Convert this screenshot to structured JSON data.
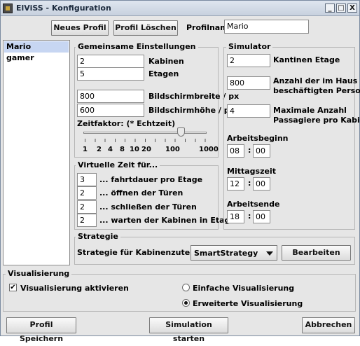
{
  "window": {
    "title": "ElViSS - Konfiguration",
    "min": "_",
    "max": "□",
    "close": "X"
  },
  "toolbar": {
    "new_profile": "Neues Profil",
    "delete_profile": "Profil Löschen",
    "profile_name_label": "Profilname",
    "profile_name_value": "Mario"
  },
  "profiles": [
    "Mario",
    "gamer"
  ],
  "common": {
    "title": "Gemeinsame Einstellungen",
    "kabinen_value": "2",
    "kabinen_label": "Kabinen",
    "etagen_value": "5",
    "etagen_label": "Etagen",
    "screen_width_value": "800",
    "screen_width_label": "Bildschirmbreite / px",
    "screen_height_value": "600",
    "screen_height_label": "Bildschirmhöhe / px",
    "zeitfaktor_label": "Zeitfaktor: (* Echtzeit)",
    "slider_ticks": [
      "1",
      "2",
      "4",
      "8",
      "10",
      "20",
      "100",
      "1000"
    ],
    "slider_selected": "100"
  },
  "virtual_time": {
    "title": "Virtuelle Zeit für...",
    "items": [
      {
        "value": "3",
        "label": "... fahrtdauer pro Etage"
      },
      {
        "value": "2",
        "label": "... öffnen der Türen"
      },
      {
        "value": "2",
        "label": "... schließen der Türen"
      },
      {
        "value": "2",
        "label": "... warten der Kabinen in Etage"
      }
    ]
  },
  "simulator": {
    "title": "Simulator",
    "kantinen_value": "2",
    "kantinen_label": "Kantinen Etage",
    "persons_value": "800",
    "persons_label_1": "Anzahl der im Haus",
    "persons_label_2": "beschäftigten Personen",
    "passengers_value": "4",
    "passengers_label_1": "Maximale Anzahl",
    "passengers_label_2": "Passagiere pro Kabine",
    "arbeitsbeginn_label": "Arbeitsbeginn",
    "arbeitsbeginn_h": "08",
    "arbeitsbeginn_m": "00",
    "mittagszeit_label": "Mittagszeit",
    "mittagszeit_h": "12",
    "mittagszeit_m": "00",
    "arbeitsende_label": "Arbeitsende",
    "arbeitsende_h": "18",
    "arbeitsende_m": "00",
    "colon": ":"
  },
  "strategy": {
    "title": "Strategie",
    "label": "Strategie für Kabinenzuteilung",
    "selected": "SmartStrategy",
    "edit": "Bearbeiten"
  },
  "visualization": {
    "title": "Visualisierung",
    "enable_label": "Visualisierung aktivieren",
    "enable_checked": true,
    "simple_label": "Einfache Visualisierung",
    "extended_label": "Erweiterte Visualisierung",
    "selected": "extended"
  },
  "footer": {
    "save": "Profil Speichern",
    "start": "Simulation starten",
    "cancel": "Abbrechen"
  }
}
